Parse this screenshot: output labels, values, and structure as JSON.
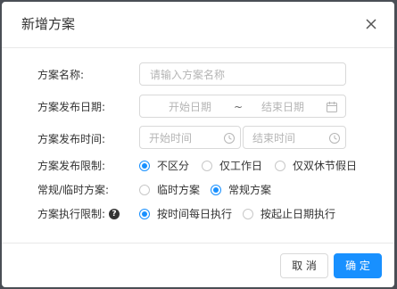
{
  "dialog": {
    "title": "新增方案",
    "close_icon": "close-icon"
  },
  "form": {
    "name": {
      "label": "方案名称:",
      "placeholder": "请输入方案名称"
    },
    "publish_date": {
      "label": "方案发布日期:",
      "start_placeholder": "开始日期",
      "separator": "~",
      "end_placeholder": "结束日期",
      "icon": "calendar-icon"
    },
    "publish_time": {
      "label": "方案发布时间:",
      "start_placeholder": "开始时间",
      "end_placeholder": "结束时间",
      "icon": "clock-icon"
    },
    "publish_limit": {
      "label": "方案发布限制:",
      "options": [
        "不区分",
        "仅工作日",
        "仅双休节假日"
      ],
      "selected": "不区分"
    },
    "plan_type": {
      "label": "常规/临时方案:",
      "options": [
        "临时方案",
        "常规方案"
      ],
      "selected": "常规方案"
    },
    "exec_limit": {
      "label": "方案执行限制:",
      "help_icon": "help-icon",
      "help_glyph": "?",
      "options": [
        "按时间每日执行",
        "按起止日期执行"
      ],
      "selected": "按时间每日执行"
    }
  },
  "footer": {
    "cancel_label": "取 消",
    "ok_label": "确 定"
  },
  "colors": {
    "accent": "#1890ff",
    "border": "#d9d9d9",
    "placeholder": "#b5b5b5"
  }
}
